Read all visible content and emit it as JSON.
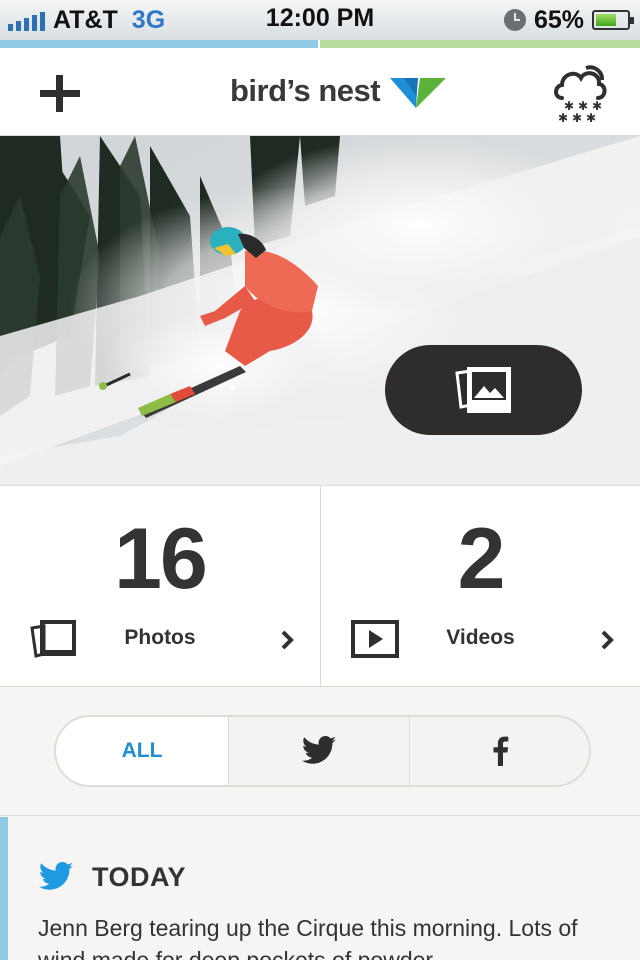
{
  "status_bar": {
    "carrier": "AT&T",
    "network": "3G",
    "time": "12:00 PM",
    "battery_percent": "65%",
    "battery_level": 0.65,
    "signal_bars": 5
  },
  "nav": {
    "add_icon": "plus-icon",
    "logo_text": "bird’s nest",
    "weather_icon": "snow-cloud-icon"
  },
  "hero": {
    "gallery_icon": "photo-gallery-icon"
  },
  "stats": {
    "photos": {
      "count": "16",
      "label": "Photos"
    },
    "videos": {
      "count": "2",
      "label": "Videos"
    }
  },
  "filter": {
    "all_label": "ALL",
    "twitter_icon": "twitter-bird-icon",
    "facebook_icon": "facebook-f-icon",
    "active": "ALL"
  },
  "feed": {
    "heading": "TODAY",
    "text": "Jenn Berg tearing up the Cirque this morning. Lots of wind made for deep pockets of powder."
  },
  "colors": {
    "accent_blue": "#1f8fd0",
    "strip_blue": "#8fcbe4",
    "strip_green": "#b8dca0",
    "logo_blue": "#1e8ed6",
    "logo_green": "#5cb23a",
    "dark_button": "#2e2d2c"
  }
}
